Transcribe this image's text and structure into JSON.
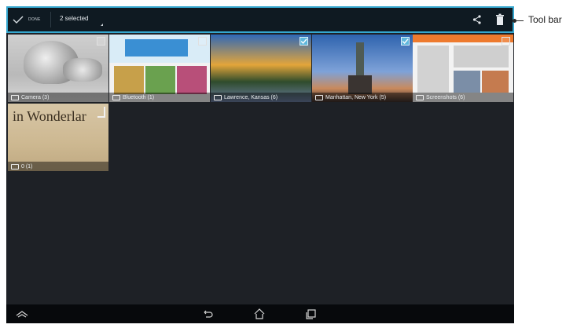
{
  "toolbar": {
    "done_label": "DONE",
    "selected_label": "2 selected",
    "accent": "#35a7cf"
  },
  "albums": [
    {
      "label": "Camera (3)",
      "selected": false,
      "icon": "camera-icon"
    },
    {
      "label": "Bluetooth (1)",
      "selected": false,
      "icon": "folder-icon"
    },
    {
      "label": "Lawrence, Kansas (6)",
      "selected": true,
      "icon": "folder-icon"
    },
    {
      "label": "Manhattan, New York (5)",
      "selected": true,
      "icon": "folder-icon"
    },
    {
      "label": "Screenshots (6)",
      "selected": false,
      "icon": "folder-icon"
    },
    {
      "label": "0 (1)",
      "selected": false,
      "icon": "folder-icon",
      "image_text": "in Wonderlar"
    }
  ],
  "navigation": {
    "icons": [
      "collapse-icon",
      "back-icon",
      "home-icon",
      "recent-apps-icon"
    ]
  },
  "callout": {
    "label": "Tool bar"
  }
}
